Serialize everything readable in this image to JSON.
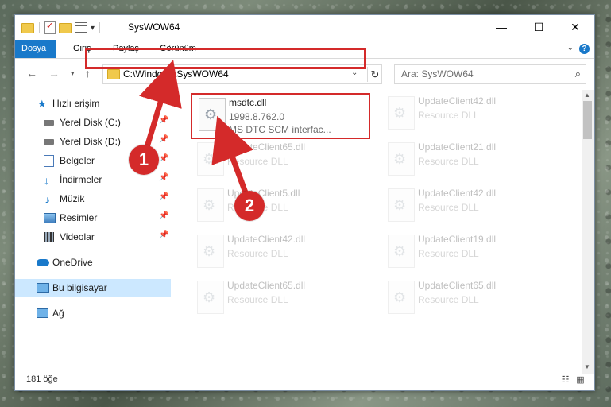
{
  "window": {
    "title": "SysWOW64",
    "controls": {
      "minimize": "—",
      "maximize": "☐",
      "close": "✕"
    }
  },
  "ribbon": {
    "tabs": [
      {
        "label": "Dosya"
      },
      {
        "label": "Giriş"
      },
      {
        "label": "Paylaş"
      },
      {
        "label": "Görünüm"
      }
    ],
    "help": "?"
  },
  "address": {
    "path": "C:\\Windows\\SysWOW64",
    "search_placeholder": "Ara: SysWOW64"
  },
  "sidebar": {
    "items": [
      {
        "label": "Hızlı erişim",
        "icon": "star-icon"
      },
      {
        "label": "Yerel Disk (C:)",
        "icon": "drive-icon"
      },
      {
        "label": "Yerel Disk (D:)",
        "icon": "drive-icon"
      },
      {
        "label": "Belgeler",
        "icon": "documents-icon"
      },
      {
        "label": "İndirmeler",
        "icon": "download-icon"
      },
      {
        "label": "Müzik",
        "icon": "music-icon"
      },
      {
        "label": "Resimler",
        "icon": "pictures-icon"
      },
      {
        "label": "Videolar",
        "icon": "videos-icon"
      },
      {
        "label": "OneDrive",
        "icon": "cloud-icon"
      },
      {
        "label": "Bu bilgisayar",
        "icon": "computer-icon"
      },
      {
        "label": "Ağ",
        "icon": "network-icon"
      }
    ]
  },
  "files": {
    "highlighted": {
      "name": "msdtc.dll",
      "version": "1998.8.762.0",
      "description": "MS DTC SCM interfac..."
    },
    "column1": [
      {
        "name": "UpdateClient65.dll",
        "description": "Resource DLL"
      },
      {
        "name": "UpdateClient5.dll",
        "description": "Resource DLL"
      },
      {
        "name": "UpdateClient42.dll",
        "description": "Resource DLL"
      },
      {
        "name": "UpdateClient65.dll",
        "description": "Resource DLL"
      }
    ],
    "column2": [
      {
        "name": "UpdateClient42.dll",
        "description": "Resource DLL"
      },
      {
        "name": "UpdateClient21.dll",
        "description": "Resource DLL"
      },
      {
        "name": "UpdateClient42.dll",
        "description": "Resource DLL"
      },
      {
        "name": "UpdateClient19.dll",
        "description": "Resource DLL"
      },
      {
        "name": "UpdateClient65.dll",
        "description": "Resource DLL"
      }
    ]
  },
  "status": {
    "count": "181 öğe"
  },
  "annotations": {
    "step1": "1",
    "step2": "2",
    "accent": "#d42a2a"
  }
}
